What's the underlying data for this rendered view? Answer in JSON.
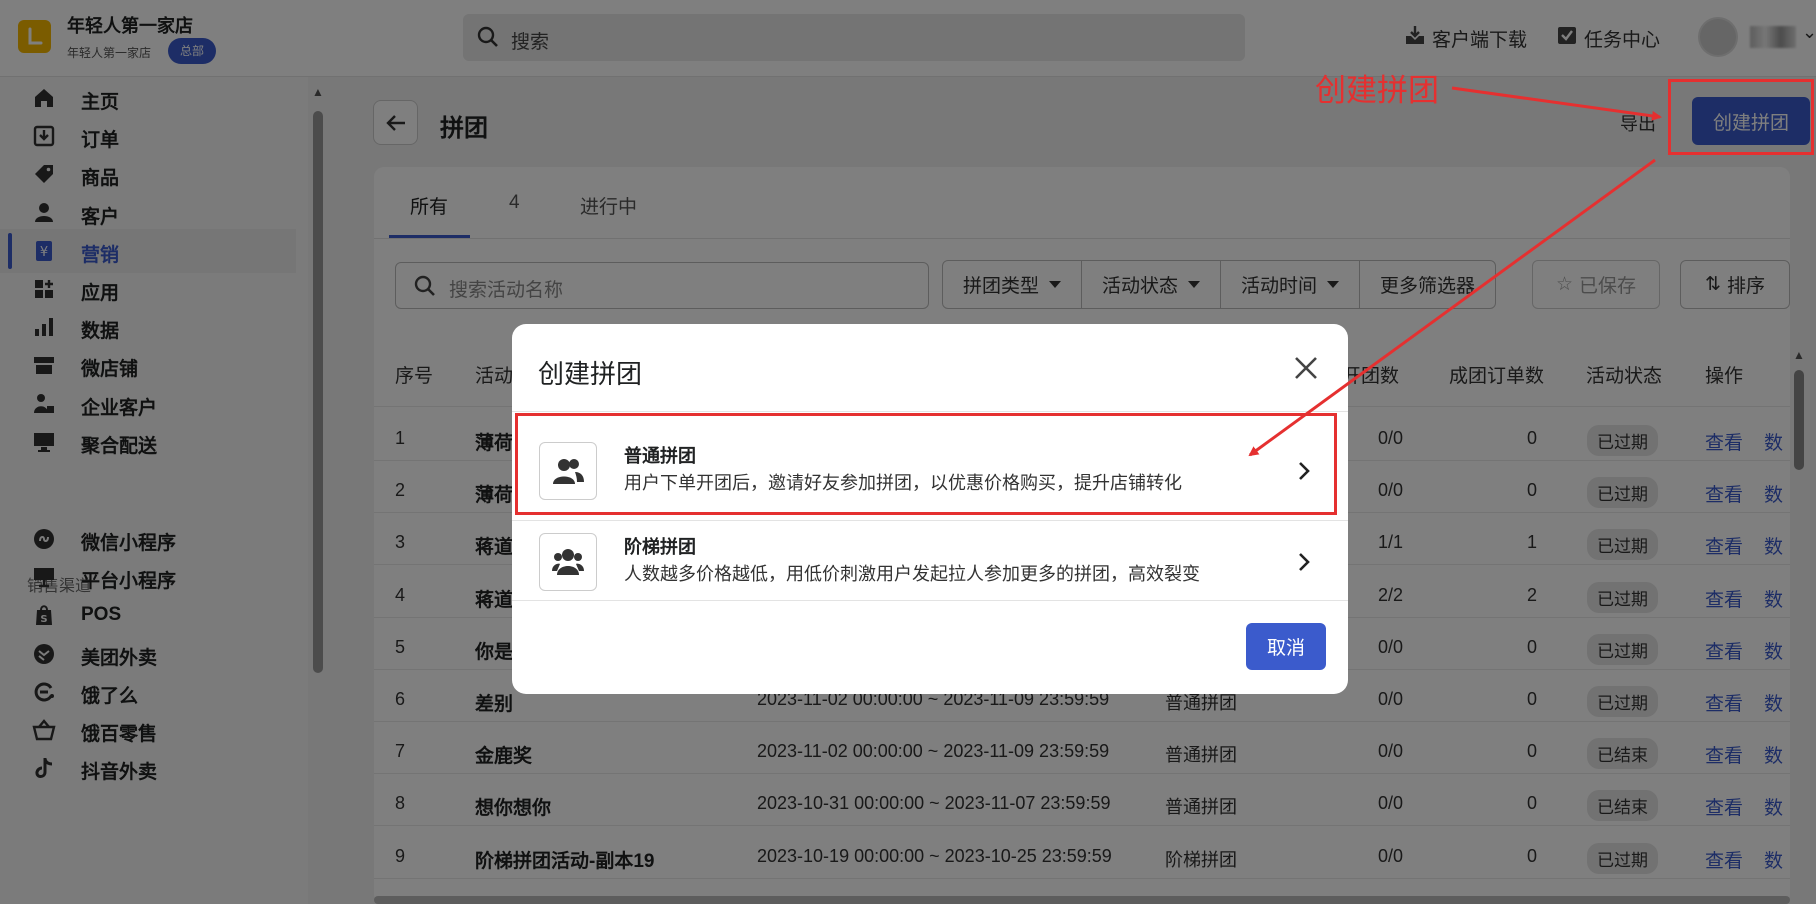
{
  "topbar": {
    "store_name": "年轻人第一家店",
    "store_sub": "年轻人第一家店",
    "hq_badge": "总部",
    "search_placeholder": "搜索",
    "download_label": "客户端下载",
    "task_label": "任务中心"
  },
  "sidebar": {
    "items": [
      {
        "label": "主页",
        "icon": "home-icon"
      },
      {
        "label": "订单",
        "icon": "order-icon"
      },
      {
        "label": "商品",
        "icon": "tag-icon"
      },
      {
        "label": "客户",
        "icon": "person-icon"
      },
      {
        "label": "营销",
        "icon": "marketing-icon",
        "active": true
      },
      {
        "label": "应用",
        "icon": "apps-icon"
      },
      {
        "label": "数据",
        "icon": "bar-chart-icon"
      },
      {
        "label": "微店铺",
        "icon": "store-icon"
      },
      {
        "label": "企业客户",
        "icon": "enterprise-icon"
      },
      {
        "label": "聚合配送",
        "icon": "delivery-icon"
      }
    ],
    "channels_title": "销售渠道",
    "channels": [
      {
        "label": "微信小程序",
        "icon": "wechat-miniapp-icon"
      },
      {
        "label": "平台小程序",
        "icon": "platform-miniapp-icon"
      },
      {
        "label": "POS",
        "icon": "pos-icon"
      },
      {
        "label": "美团外卖",
        "icon": "meituan-icon"
      },
      {
        "label": "饿了么",
        "icon": "eleme-icon"
      },
      {
        "label": "饿百零售",
        "icon": "basket-icon"
      },
      {
        "label": "抖音外卖",
        "icon": "douyin-icon"
      }
    ]
  },
  "page": {
    "title": "拼团",
    "export_label": "导出",
    "create_label": "创建拼团"
  },
  "tabs": [
    "所有",
    "4",
    "进行中"
  ],
  "filters": {
    "search_placeholder": "搜索活动名称",
    "options": [
      "拼团类型",
      "活动状态",
      "活动时间",
      "更多筛选器"
    ],
    "saved_label": "已保存",
    "sort_label": "排序"
  },
  "table": {
    "headers": {
      "index": "序号",
      "name": "活动",
      "groups": "开团数",
      "orders": "成团订单数",
      "status": "活动状态",
      "actions": "操作"
    },
    "rows": [
      {
        "index": "1",
        "name": "薄荷",
        "time": "",
        "type": "",
        "groups": "0/0",
        "orders": "0",
        "status": "已过期",
        "view": "查看",
        "data": "数"
      },
      {
        "index": "2",
        "name": "薄荷",
        "time": "",
        "type": "",
        "groups": "0/0",
        "orders": "0",
        "status": "已过期",
        "view": "查看",
        "data": "数"
      },
      {
        "index": "3",
        "name": "蒋道",
        "time": "",
        "type": "",
        "groups": "1/1",
        "orders": "1",
        "status": "已过期",
        "view": "查看",
        "data": "数"
      },
      {
        "index": "4",
        "name": "蒋道",
        "time": "",
        "type": "",
        "groups": "2/2",
        "orders": "2",
        "status": "已过期",
        "view": "查看",
        "data": "数"
      },
      {
        "index": "5",
        "name": "你是",
        "time": "",
        "type": "",
        "groups": "0/0",
        "orders": "0",
        "status": "已过期",
        "view": "查看",
        "data": "数"
      },
      {
        "index": "6",
        "name": "差别",
        "time": "2023-11-02 00:00:00 ~ 2023-11-09 23:59:59",
        "type": "普通拼团",
        "groups": "0/0",
        "orders": "0",
        "status": "已过期",
        "view": "查看",
        "data": "数"
      },
      {
        "index": "7",
        "name": "金鹿奖",
        "time": "2023-11-02 00:00:00 ~ 2023-11-09 23:59:59",
        "type": "普通拼团",
        "groups": "0/0",
        "orders": "0",
        "status": "已结束",
        "view": "查看",
        "data": "数"
      },
      {
        "index": "8",
        "name": "想你想你",
        "time": "2023-10-31 00:00:00 ~ 2023-11-07 23:59:59",
        "type": "普通拼团",
        "groups": "0/0",
        "orders": "0",
        "status": "已结束",
        "view": "查看",
        "data": "数"
      },
      {
        "index": "9",
        "name": "阶梯拼团活动-副本19",
        "time": "2023-10-19 00:00:00 ~ 2023-10-25 23:59:59",
        "type": "阶梯拼团",
        "groups": "0/0",
        "orders": "0",
        "status": "已过期",
        "view": "查看",
        "data": "数"
      }
    ]
  },
  "modal": {
    "title": "创建拼团",
    "options": [
      {
        "title": "普通拼团",
        "desc": "用户下单开团后，邀请好友参加拼团，以优惠价格购买，提升店铺转化"
      },
      {
        "title": "阶梯拼团",
        "desc": "人数越多价格越低，用低价刺激用户发起拉人参加更多的拼团，高效裂变"
      }
    ],
    "cancel_label": "取消"
  },
  "annotation": {
    "label": "创建拼团",
    "color": "#e53030"
  },
  "colors": {
    "accent": "#3b5bcc",
    "logo": "#f6b800"
  }
}
